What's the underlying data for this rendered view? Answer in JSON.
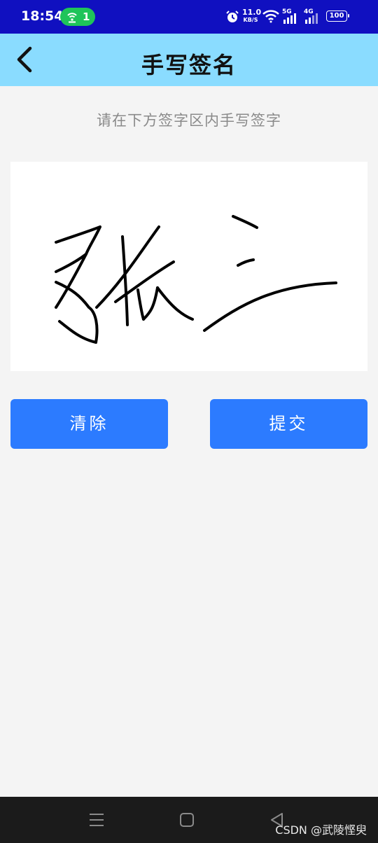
{
  "status_bar": {
    "time": "18:54",
    "pill_count": "1",
    "net_speed_value": "11.0",
    "net_speed_unit": "KB/S",
    "signal_5g": "5G",
    "signal_4g": "4G",
    "battery": "100",
    "icons": [
      "hotspot-icon",
      "alarm-icon",
      "wifi-icon",
      "signal-5g-icon",
      "signal-4g-icon",
      "battery-icon"
    ]
  },
  "header": {
    "title": "手写签名",
    "back_icon": "chevron-left-icon"
  },
  "hint": "请在下方签字区内手写签字",
  "signature_pad": {
    "stroke_color": "#000000",
    "background": "#ffffff"
  },
  "buttons": {
    "clear": "清除",
    "submit": "提交"
  },
  "nav_bar": {
    "items": [
      "menu-icon",
      "home-icon",
      "back-triangle-icon"
    ]
  },
  "watermark": "CSDN @武陵悭臾",
  "colors": {
    "status_bar": "#1010c0",
    "header": "#8adcff",
    "button": "#2c7bff",
    "pill": "#1fc45a"
  }
}
